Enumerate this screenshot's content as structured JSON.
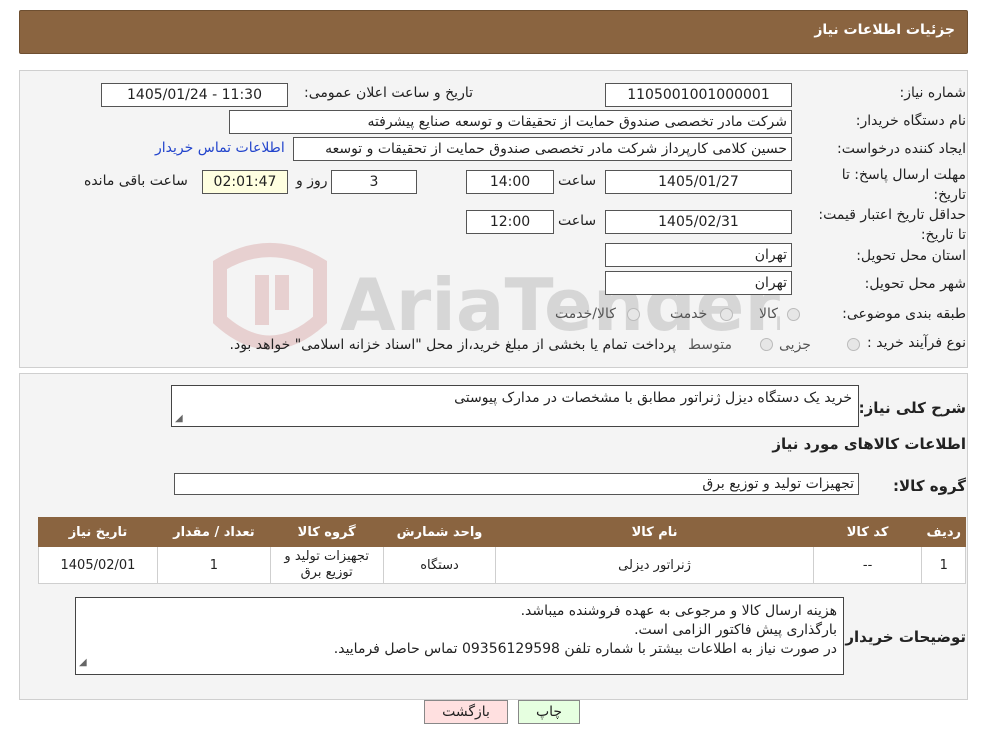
{
  "header": {
    "title": "جزئیات اطلاعات نیاز"
  },
  "watermark": {
    "text": "AriaTender.neT"
  },
  "form": {
    "need_number_label": "شماره نیاز:",
    "need_number": "1105001001000001",
    "announce_label": "تاریخ و ساعت اعلان عمومی:",
    "announce_value": "1405/01/24 - 11:30",
    "buyer_org_label": "نام دستگاه خریدار:",
    "buyer_org": "شرکت مادر تخصصی صندوق حمایت از تحقیقات و توسعه صنایع پیشرفته",
    "requester_label": "ایجاد کننده درخواست:",
    "requester": "حسین کلامی کارپرداز شرکت مادر تخصصی صندوق حمایت از تحقیقات و توسعه",
    "contact_link": "اطلاعات تماس خریدار",
    "deadline_label": "مهلت ارسال پاسخ: تا تاریخ:",
    "deadline_date": "1405/01/27",
    "time_word": "ساعت",
    "deadline_time": "14:00",
    "days_value": "3",
    "days_and": "روز و",
    "remaining_time": "02:01:47",
    "remaining_label": "ساعت باقی مانده",
    "validity_label": "حداقل تاریخ اعتبار قیمت: تا تاریخ:",
    "validity_date": "1405/02/31",
    "validity_time": "12:00",
    "province_label": "استان محل تحویل:",
    "province": "تهران",
    "city_label": "شهر محل تحویل:",
    "city": "تهران",
    "category_label": "طبقه بندی موضوعی:",
    "category_options": [
      "کالا",
      "خدمت",
      "کالا/خدمت"
    ],
    "process_label": "نوع فرآیند خرید :",
    "process_options": [
      "جزیی",
      "متوسط"
    ],
    "process_note": "پرداخت تمام یا بخشی از مبلغ خرید،از محل \"اسناد خزانه اسلامی\" خواهد بود."
  },
  "summary": {
    "label": "شرح کلی نیاز:",
    "value": "خرید یک دستگاه دیزل ژنراتور مطابق با مشخصات در مدارک پیوستی",
    "goods_info_title": "اطلاعات کالاهای مورد نیاز",
    "goods_group_label": "گروه کالا:",
    "goods_group": "تجهیزات تولید و توزیع برق"
  },
  "table": {
    "headers": [
      "ردیف",
      "کد کالا",
      "نام کالا",
      "واحد شمارش",
      "گروه کالا",
      "تعداد / مقدار",
      "تاریخ نیاز"
    ],
    "rows": [
      [
        "1",
        "--",
        "ژنراتور دیزلی",
        "دستگاه",
        "تجهیزات تولید و توزیع برق",
        "1",
        "1405/02/01"
      ]
    ]
  },
  "buyer_notes": {
    "label": "توضیحات خریدار:",
    "lines": [
      "هزینه ارسال کالا و مرجوعی به عهده فروشنده میباشد.",
      "بارگذاری پیش فاکتور الزامی است.",
      "در صورت نیاز به اطلاعات بیشتر با شماره تلفن 09356129598 تماس حاصل فرمایید."
    ]
  },
  "buttons": {
    "print": "چاپ",
    "back": "بازگشت"
  },
  "colors": {
    "header_brown": "#8a6440",
    "print_bg": "#e6ffe0",
    "back_bg": "#ffe0e0"
  }
}
